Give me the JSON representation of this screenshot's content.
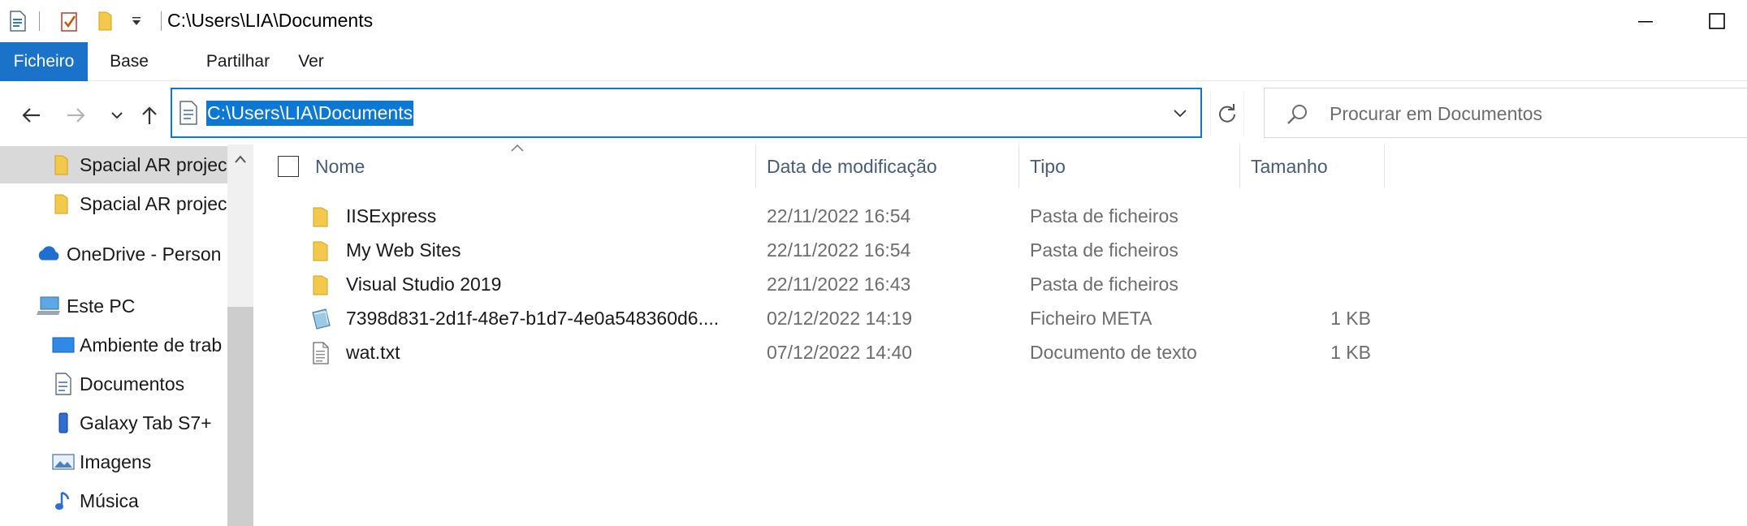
{
  "titlebar": {
    "title": "C:\\Users\\LIA\\Documents",
    "quick_access_icons": [
      "properties-icon",
      "checkmark-icon",
      "new-folder-icon",
      "customize-dropdown-icon"
    ],
    "window_buttons": [
      "minimize-icon",
      "maximize-icon"
    ]
  },
  "ribbon": {
    "tabs": [
      {
        "label": "Ficheiro",
        "active": true
      },
      {
        "label": "Base",
        "active": false
      },
      {
        "label": "Partilhar",
        "active": false
      },
      {
        "label": "Ver",
        "active": false
      }
    ]
  },
  "navbar": {
    "buttons": [
      "back-arrow-icon",
      "forward-arrow-icon",
      "recent-locations-icon",
      "up-arrow-icon"
    ],
    "address": "C:\\Users\\LIA\\Documents",
    "search_placeholder": "Procurar em Documentos"
  },
  "navpane": {
    "items": [
      {
        "label": "Spacial AR projec",
        "icon": "folder-icon",
        "selected": true,
        "indent": 2
      },
      {
        "label": "Spacial AR projec",
        "icon": "folder-icon",
        "selected": false,
        "indent": 2
      },
      {
        "label": "OneDrive - Person",
        "icon": "onedrive-cloud-icon",
        "selected": false,
        "indent": 1
      },
      {
        "label": "Este PC",
        "icon": "pc-icon",
        "selected": false,
        "indent": 1
      },
      {
        "label": "Ambiente de trab",
        "icon": "desktop-icon",
        "selected": false,
        "indent": 2
      },
      {
        "label": "Documentos",
        "icon": "documents-icon",
        "selected": false,
        "indent": 2
      },
      {
        "label": "Galaxy Tab S7+",
        "icon": "tablet-icon",
        "selected": false,
        "indent": 2
      },
      {
        "label": "Imagens",
        "icon": "pictures-icon",
        "selected": false,
        "indent": 2
      },
      {
        "label": "Música",
        "icon": "music-icon",
        "selected": false,
        "indent": 2
      }
    ]
  },
  "filelist": {
    "columns": {
      "name": "Nome",
      "date": "Data de modificação",
      "type": "Tipo",
      "size": "Tamanho"
    },
    "sorted_by": "name",
    "rows": [
      {
        "name": "IISExpress",
        "date": "22/11/2022 16:54",
        "type": "Pasta de ficheiros",
        "size": "",
        "icon": "folder-icon"
      },
      {
        "name": "My Web Sites",
        "date": "22/11/2022 16:54",
        "type": "Pasta de ficheiros",
        "size": "",
        "icon": "folder-icon"
      },
      {
        "name": "Visual Studio 2019",
        "date": "22/11/2022 16:43",
        "type": "Pasta de ficheiros",
        "size": "",
        "icon": "folder-icon"
      },
      {
        "name": "7398d831-2d1f-48e7-b1d7-4e0a548360d6....",
        "date": "02/12/2022 14:19",
        "type": "Ficheiro META",
        "size": "1 KB",
        "icon": "meta-file-icon"
      },
      {
        "name": "wat.txt",
        "date": "07/12/2022 14:40",
        "type": "Documento de texto",
        "size": "1 KB",
        "icon": "text-file-icon"
      }
    ]
  },
  "colors": {
    "accent": "#0a78d4",
    "ribbon_active": "#1a73c9",
    "folder": "#f2c94c",
    "selection_gray": "#d9d9d9"
  }
}
